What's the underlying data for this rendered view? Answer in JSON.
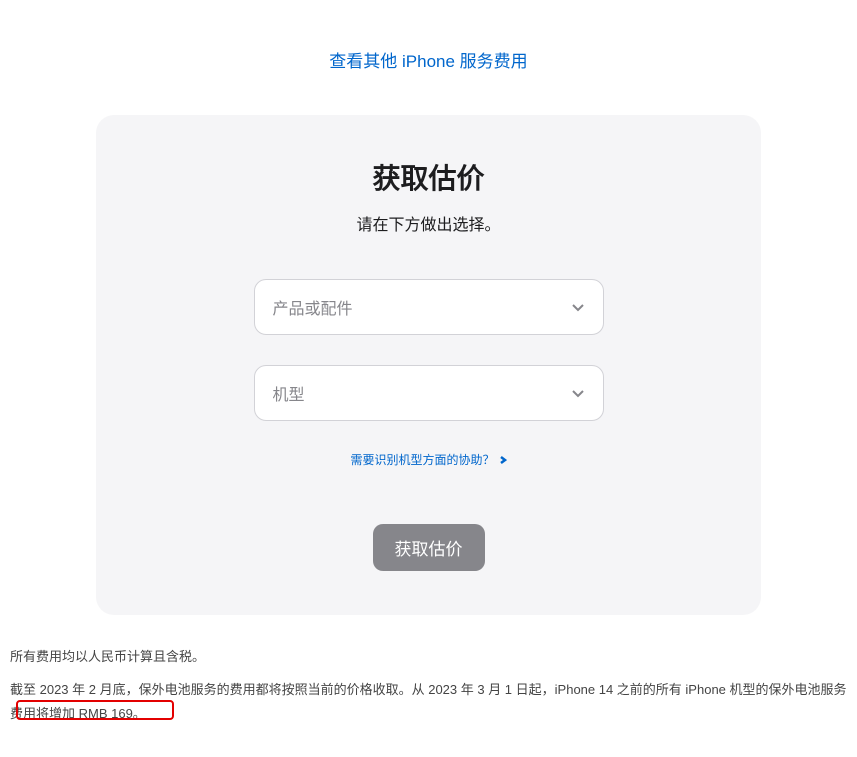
{
  "topLink": "查看其他 iPhone 服务费用",
  "card": {
    "title": "获取估价",
    "subtitle": "请在下方做出选择。",
    "select1": "产品或配件",
    "select2": "机型",
    "helpLink": "需要识别机型方面的协助？",
    "submit": "获取估价"
  },
  "footer": {
    "line1": "所有费用均以人民币计算且含税。",
    "line2": "截至 2023 年 2 月底，保外电池服务的费用都将按照当前的价格收取。从 2023 年 3 月 1 日起，iPhone 14 之前的所有 iPhone 机型的保外电池服务费用将增加 RMB 169。"
  }
}
